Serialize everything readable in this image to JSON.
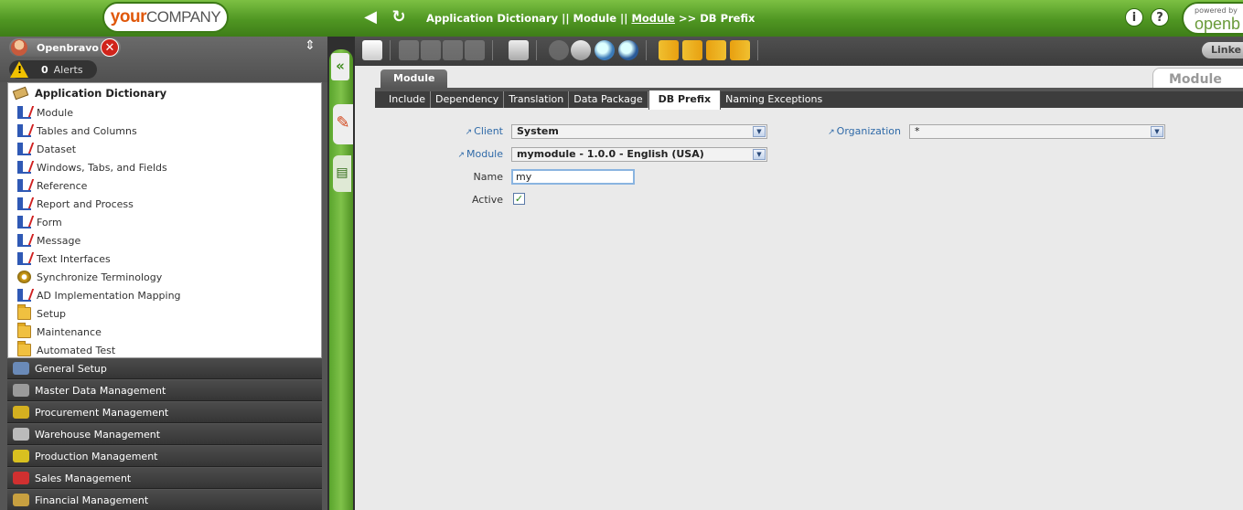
{
  "topbar": {
    "logo_your": "your",
    "logo_company": "COMPANY",
    "breadcrumb_part1": "Application Dictionary || Module  ||",
    "breadcrumb_link": "Module",
    "breadcrumb_part2": ">> DB Prefix",
    "powered_by": "powered by",
    "powered_brand": "openb"
  },
  "user": {
    "name": "Openbravo",
    "alerts_count": "0",
    "alerts_label": "Alerts"
  },
  "menu": {
    "header": "Application Dictionary",
    "items": [
      {
        "label": "Module",
        "icon": "window-icon"
      },
      {
        "label": "Tables and Columns",
        "icon": "window-icon"
      },
      {
        "label": "Dataset",
        "icon": "window-icon"
      },
      {
        "label": "Windows, Tabs, and Fields",
        "icon": "window-icon"
      },
      {
        "label": "Reference",
        "icon": "window-icon"
      },
      {
        "label": "Report and Process",
        "icon": "window-icon"
      },
      {
        "label": "Form",
        "icon": "window-icon"
      },
      {
        "label": "Message",
        "icon": "window-icon"
      },
      {
        "label": "Text Interfaces",
        "icon": "window-icon"
      },
      {
        "label": "Synchronize Terminology",
        "icon": "process-icon"
      },
      {
        "label": "AD Implementation Mapping",
        "icon": "window-icon"
      },
      {
        "label": "Setup",
        "icon": "folder-icon"
      },
      {
        "label": "Maintenance",
        "icon": "folder-icon"
      },
      {
        "label": "Automated Test",
        "icon": "folder-icon"
      }
    ],
    "sections": [
      {
        "label": "General Setup",
        "color": "#6a8ab8"
      },
      {
        "label": "Master Data Management",
        "color": "#9a9a9a"
      },
      {
        "label": "Procurement Management",
        "color": "#d4b020"
      },
      {
        "label": "Warehouse Management",
        "color": "#bbbbbb"
      },
      {
        "label": "Production Management",
        "color": "#d8c020"
      },
      {
        "label": "Sales Management",
        "color": "#d03030"
      },
      {
        "label": "Financial Management",
        "color": "#c8a040"
      }
    ]
  },
  "toolbar": {
    "linked_label": "Linke"
  },
  "tabs": {
    "header_tab": "Module",
    "module_title": "Module",
    "subtabs": [
      "Include",
      "Dependency",
      "Translation",
      "Data Package",
      "DB Prefix",
      "Naming Exceptions"
    ],
    "active_subtab": "DB Prefix"
  },
  "form": {
    "client_label": "Client",
    "client_value": "System",
    "organization_label": "Organization",
    "organization_value": "*",
    "module_label": "Module",
    "module_value": "mymodule - 1.0.0 - English (USA)",
    "name_label": "Name",
    "name_value": "my",
    "active_label": "Active",
    "active_checked": true
  },
  "colors": {
    "accent_green": "#5aa52d",
    "link_blue": "#2f6aa8",
    "logo_orange": "#e0580b"
  }
}
